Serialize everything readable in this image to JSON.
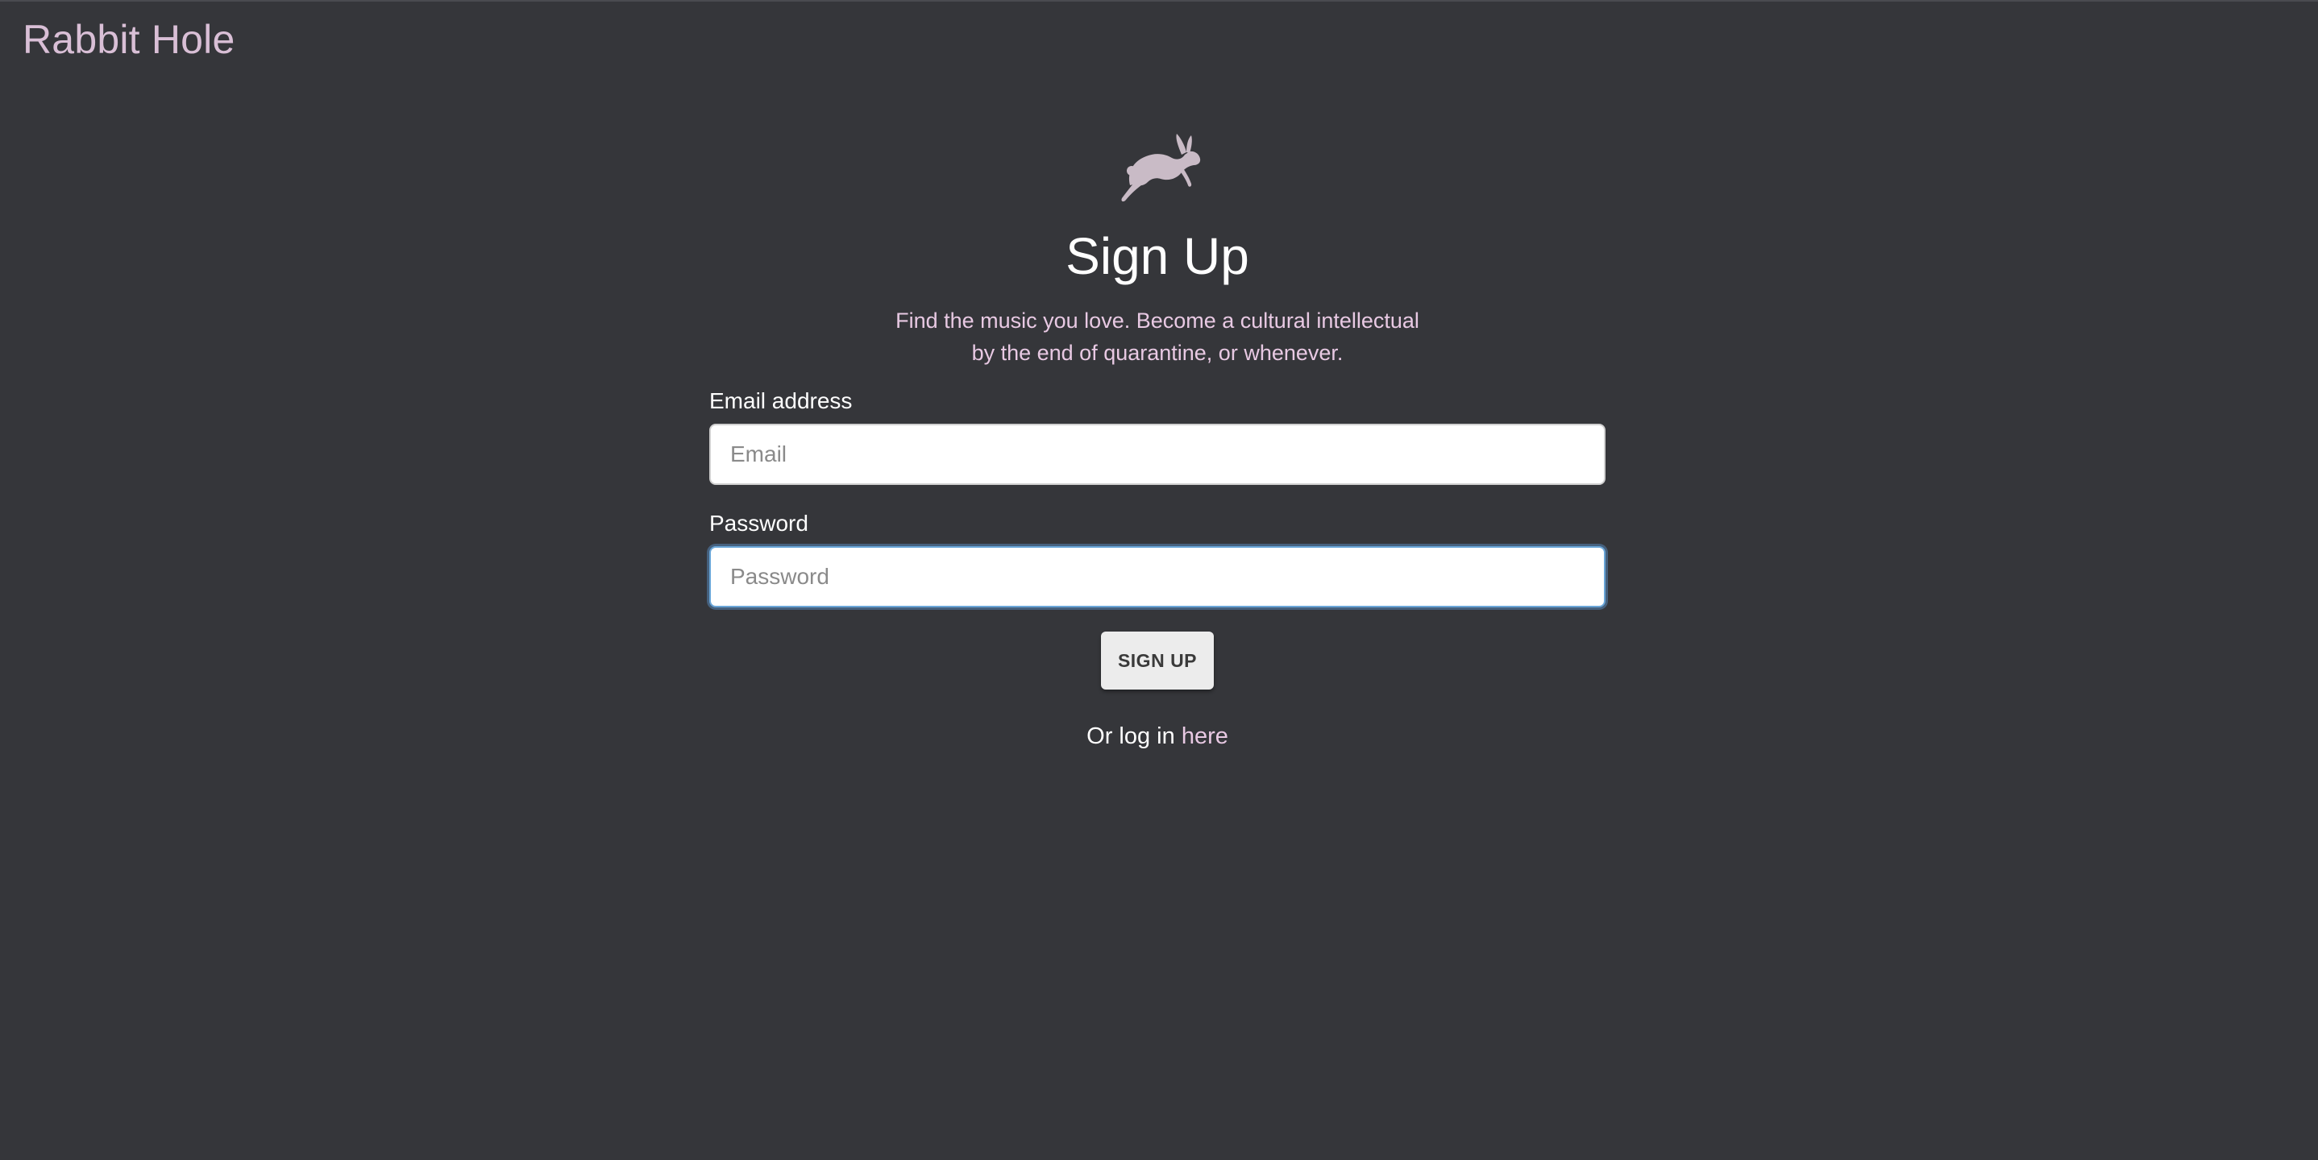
{
  "brand": "Rabbit Hole",
  "logo_icon": "rabbit-icon",
  "colors": {
    "background": "#35363a",
    "accent": "#d9bfd6",
    "button": "#ececec"
  },
  "signup": {
    "title": "Sign Up",
    "subtitle_line1": "Find the music you love. Become a cultural intellectual",
    "subtitle_line2": "by the end of quarantine, or whenever.",
    "email_label": "Email address",
    "email_placeholder": "Email",
    "email_value": "",
    "password_label": "Password",
    "password_placeholder": "Password",
    "password_value": "",
    "button_label": "SIGN UP",
    "login_prefix": "Or log in ",
    "login_link": "here"
  }
}
